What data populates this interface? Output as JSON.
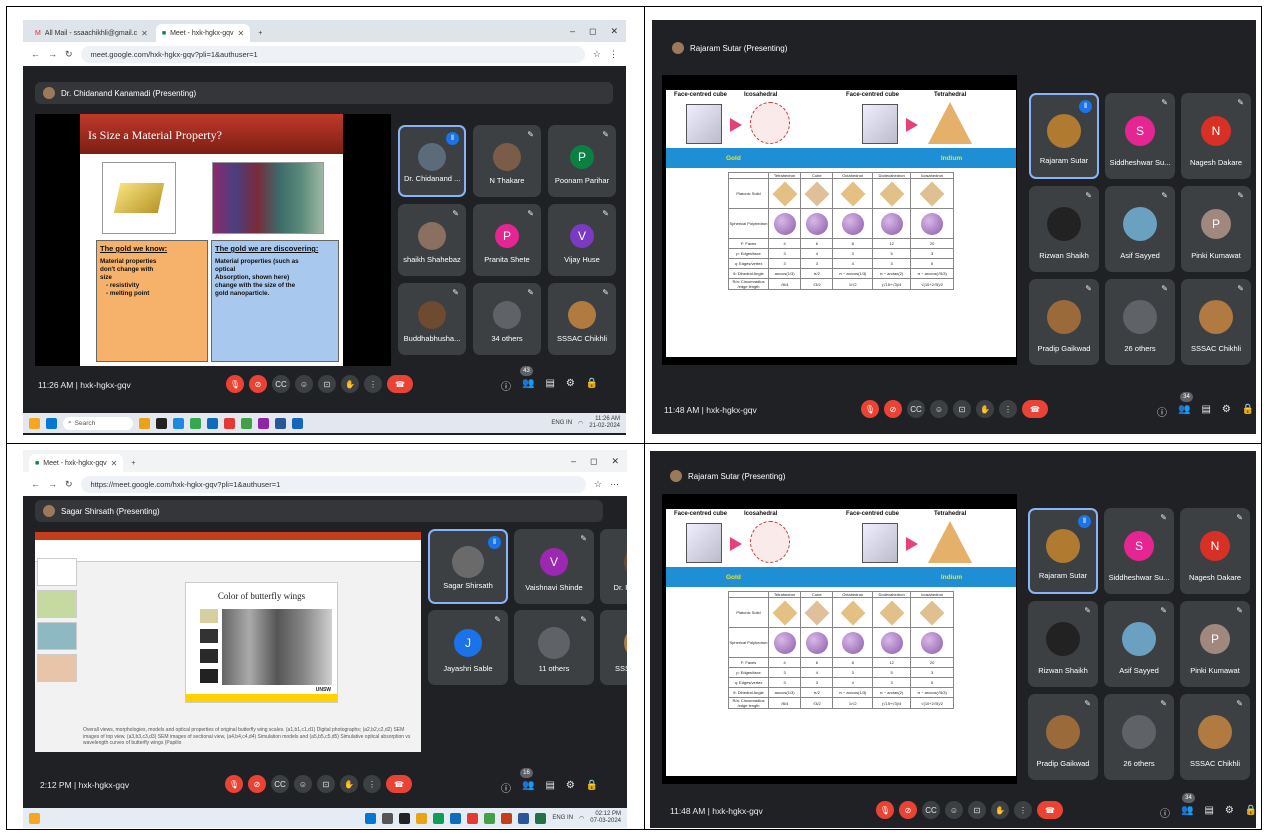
{
  "q1": {
    "tabs": [
      "All Mail - ssaachikhli@gmail.c",
      "Meet - hxk-hgkx-gqv"
    ],
    "url": "meet.google.com/hxk-hgkx-gqv?pli=1&authuser=1",
    "presenter": "Dr. Chidanand Kanamadi (Presenting)",
    "slide": {
      "title": "Is Size a Material Property?",
      "left_head": "The gold we know:",
      "left_body": [
        "Material properties",
        "don't change with",
        "size",
        "- resistivity",
        "- melting point"
      ],
      "right_head": "The gold we are discovering:",
      "right_body": [
        "Material properties (such as",
        "optical",
        "Absorption, shown here)",
        "change with the size of the",
        "gold nanoparticle."
      ]
    },
    "tiles": [
      {
        "name": "Dr. Chidanand ...",
        "initial": "",
        "color": "#5b6b7a"
      },
      {
        "name": "N Thakare",
        "initial": "",
        "color": "#7a5c48"
      },
      {
        "name": "Poonam Parihar",
        "initial": "P",
        "color": "#0b8043"
      },
      {
        "name": "shaikh Shahebaz",
        "initial": "",
        "color": "#8a7060"
      },
      {
        "name": "Pranita Shete",
        "initial": "P",
        "color": "#e52592"
      },
      {
        "name": "Vijay Huse",
        "initial": "V",
        "color": "#7b3ac2"
      },
      {
        "name": "Buddhabhusha...",
        "initial": "",
        "color": "#6e4a30"
      },
      {
        "name": "34 others",
        "initial": "",
        "color": "#5f6368"
      },
      {
        "name": "SSSAC Chikhli",
        "initial": "",
        "color": "#b07a40"
      }
    ],
    "time": "11:26 AM",
    "code": "hxk-hgkx-gqv",
    "count": "43",
    "taskbar_search": "Search",
    "tray_lang": "ENG IN",
    "tray_time": "11:26 AM",
    "tray_date": "21-02-2024"
  },
  "q2": {
    "presenter": "Rajaram Sutar (Presenting)",
    "slide": {
      "labels": [
        "Face-centred cube",
        "Icosahedral",
        "Face-centred cube",
        "Tetrahedral"
      ],
      "band": [
        "Gold",
        "Indium"
      ],
      "cols": [
        "Tetrahedron",
        "Cube",
        "Octahedron",
        "Dodecahedron",
        "Icosahedron"
      ],
      "rows": [
        {
          "label": "Platonic Solid"
        },
        {
          "label": "Spherical Polyhedron"
        },
        {
          "label": "F: Faces",
          "vals": [
            "4",
            "6",
            "8",
            "12",
            "20"
          ]
        },
        {
          "label": "p: Edges/face",
          "vals": [
            "3",
            "4",
            "3",
            "5",
            "3"
          ]
        },
        {
          "label": "q: Edges/vertex",
          "vals": [
            "3",
            "3",
            "4",
            "3",
            "5"
          ]
        },
        {
          "label": "θ: Dihedral Angle",
          "vals": [
            "arccos(1/3)",
            "π/2",
            "π − arccos(1/3)",
            "π − arctan(2)",
            "π − arccos(√5/3)"
          ]
        },
        {
          "label": "R/a: Circumradius /edge length",
          "vals": [
            "√6/4",
            "√3/2",
            "1/√2",
            "(√15+√3)/4",
            "√(10+2√5)/2"
          ]
        }
      ]
    },
    "tiles": [
      {
        "name": "Rajaram Sutar",
        "initial": "",
        "color": "#b07a30"
      },
      {
        "name": "Siddheshwar Su...",
        "initial": "S",
        "color": "#e52592"
      },
      {
        "name": "Nagesh Dakare",
        "initial": "N",
        "color": "#d93025"
      },
      {
        "name": "Rizwan Shaikh",
        "initial": "",
        "color": "#222222"
      },
      {
        "name": "Asif Sayyed",
        "initial": "",
        "color": "#6aa0c0"
      },
      {
        "name": "Pinki Kumawat",
        "initial": "P",
        "color": "#a1887f"
      },
      {
        "name": "Pradip Gaikwad",
        "initial": "",
        "color": "#9b6a3a"
      },
      {
        "name": "26 others",
        "initial": "",
        "color": "#5f6368"
      },
      {
        "name": "SSSAC Chikhli",
        "initial": "",
        "color": "#b07a40"
      }
    ],
    "time": "11:48 AM",
    "code": "hxk-hgkx-gqv",
    "count": "34"
  },
  "q3": {
    "tabs": [
      "Meet - hxk-hgkx-gqv"
    ],
    "url": "https://meet.google.com/hxk-hgkx-gqv?pli=1&authuser=1",
    "presenter": "Sagar Shirsath (Presenting)",
    "slide_title": "Color of butterfly wings",
    "slide_logo": "UNSW",
    "caption": "Overall views, morphologies, models and optical properties of original butterfly wing scales. (a1,b1,c1,d1) Digital photographs; (a2,b2,c2,d2) SEM images of top view, (a3,b3,c3,d3) SEM images of sectional view, (a4,b4,c4,d4) Simulation models and (a5,b5,c5,d5) Simulative optical absorption vs wavelength curves of butterfly wings (Papilio",
    "tiles": [
      {
        "name": "Sagar Shirsath",
        "initial": "",
        "color": "#6a6a6a"
      },
      {
        "name": "Vaishnavi Shinde",
        "initial": "V",
        "color": "#9c27b0"
      },
      {
        "name": "Dr. Pallavi Nalle",
        "initial": "",
        "color": "#6b4a36"
      },
      {
        "name": "Jayashri Sable",
        "initial": "J",
        "color": "#1a73e8"
      },
      {
        "name": "11 others",
        "initial": "",
        "color": "#5f6368"
      },
      {
        "name": "SSSAC Chikhli",
        "initial": "",
        "color": "#b07a40"
      }
    ],
    "time": "2:12 PM",
    "code": "hxk-hgkx-gqv",
    "count": "16",
    "tray_lang": "ENG IN",
    "tray_time": "02:12 PM",
    "tray_date": "07-03-2024"
  },
  "q4": {
    "presenter": "Rajaram Sutar (Presenting)",
    "tiles": [
      {
        "name": "Rajaram Sutar",
        "initial": "",
        "color": "#b07a30"
      },
      {
        "name": "Siddheshwar Su...",
        "initial": "S",
        "color": "#e52592"
      },
      {
        "name": "Nagesh Dakare",
        "initial": "N",
        "color": "#d93025"
      },
      {
        "name": "Rizwan Shaikh",
        "initial": "",
        "color": "#222222"
      },
      {
        "name": "Asif Sayyed",
        "initial": "",
        "color": "#6aa0c0"
      },
      {
        "name": "Pinki Kumawat",
        "initial": "P",
        "color": "#a1887f"
      },
      {
        "name": "Pradip Gaikwad",
        "initial": "",
        "color": "#9b6a3a"
      },
      {
        "name": "26 others",
        "initial": "",
        "color": "#5f6368"
      },
      {
        "name": "SSSAC Chikhli",
        "initial": "",
        "color": "#b07a40"
      }
    ],
    "time": "11:48 AM",
    "code": "hxk-hgkx-gqv",
    "count": "34"
  }
}
